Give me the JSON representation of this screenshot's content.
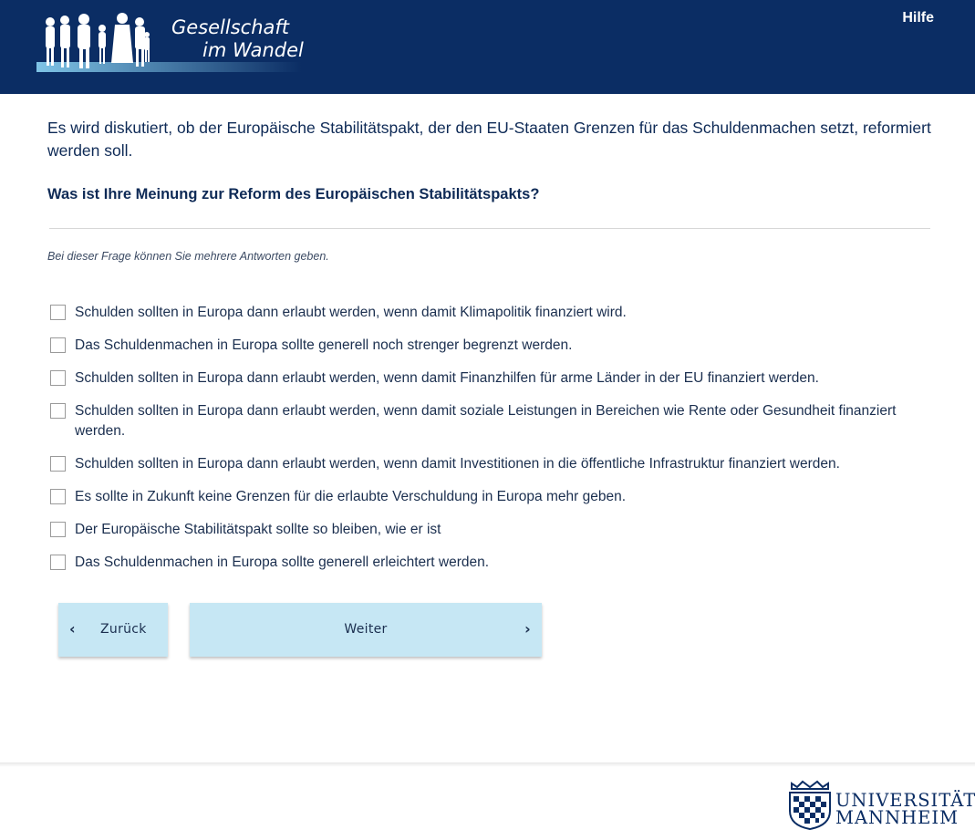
{
  "header": {
    "logo_line1": "Gesellschaft",
    "logo_line2": "im Wandel",
    "help_label": "Hilfe",
    "background_color": "#0b2d64"
  },
  "main": {
    "intro": "Es wird diskutiert, ob der Europäische Stabilitätspakt, der den EU-Staaten Grenzen für das Schuldenmachen setzt, reformiert werden soll.",
    "question": "Was ist Ihre Meinung zur Reform des Europäischen Stabilitätspakts?",
    "hint": "Bei dieser Frage können Sie mehrere Antworten geben.",
    "options": [
      {
        "label": "Schulden sollten in Europa dann erlaubt werden, wenn damit Klimapolitik finanziert wird.",
        "checked": false
      },
      {
        "label": "Das Schuldenmachen in Europa sollte generell noch strenger begrenzt werden.",
        "checked": false
      },
      {
        "label": "Schulden sollten in Europa dann erlaubt werden, wenn damit Finanzhilfen für arme Länder in der EU finanziert werden.",
        "checked": false
      },
      {
        "label": "Schulden sollten in Europa dann erlaubt werden, wenn damit soziale Leistungen in Bereichen wie Rente oder Gesundheit finanziert werden.",
        "checked": false
      },
      {
        "label": "Schulden sollten in Europa dann erlaubt werden, wenn damit Investitionen in die öffentliche Infrastruktur finanziert werden.",
        "checked": false
      },
      {
        "label": "Es sollte in Zukunft keine Grenzen für die erlaubte Verschuldung in Europa mehr geben.",
        "checked": false
      },
      {
        "label": "Der Europäische Stabilitätspakt sollte so bleiben, wie er ist",
        "checked": false
      },
      {
        "label": "Das Schuldenmachen in Europa sollte generell erleichtert werden.",
        "checked": false
      }
    ]
  },
  "nav": {
    "back_label": "Zurück",
    "next_label": "Weiter",
    "back_icon": "chevron-left-icon",
    "next_icon": "chevron-right-icon",
    "button_color": "#c6e7f4"
  },
  "footer": {
    "uni_line1": "UNIVERSITÄT",
    "uni_line2": "MANNHEIM"
  }
}
